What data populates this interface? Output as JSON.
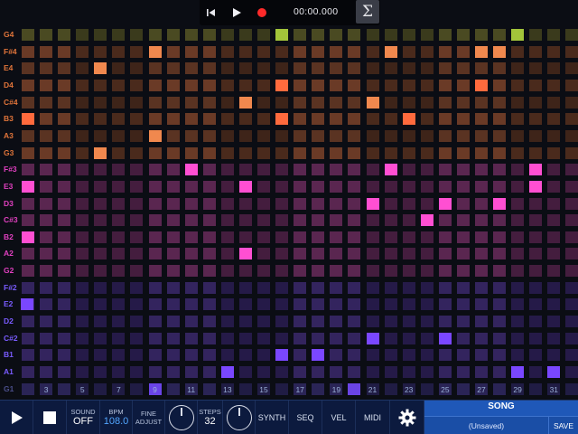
{
  "transport": {
    "time": "00:00.000",
    "sigma": "Σ",
    "icons": [
      "rewind-icon",
      "play-icon",
      "record-icon"
    ]
  },
  "grid": {
    "rows": [
      "G4",
      "F#4",
      "E4",
      "D4",
      "C#4",
      "B3",
      "A3",
      "G3",
      "F#3",
      "E3",
      "D3",
      "C#3",
      "B2",
      "A2",
      "G2",
      "F#2",
      "E2",
      "D2",
      "C#2",
      "B1",
      "A1",
      "G1"
    ],
    "step_numbers": [
      "3",
      "5",
      "7",
      "9",
      "11",
      "13",
      "15",
      "17",
      "19",
      "21",
      "23",
      "25",
      "27",
      "29",
      "31"
    ],
    "active_notes": {
      "G4": [
        15,
        28
      ],
      "F#4": [
        8,
        21,
        26,
        27
      ],
      "E4": [
        5
      ],
      "D4": [
        15,
        26
      ],
      "C#4": [
        13,
        20
      ],
      "B3": [
        1,
        15,
        22
      ],
      "A3": [
        8
      ],
      "G3": [
        5
      ],
      "F#3": [
        10,
        21,
        29
      ],
      "E3": [
        1,
        13,
        29
      ],
      "D3": [
        20,
        24,
        27
      ],
      "C#3": [
        23
      ],
      "B2": [
        1
      ],
      "A2": [
        13
      ],
      "G2": [],
      "F#2": [],
      "E2": [
        0
      ],
      "D2": [],
      "C#2": [
        20,
        24
      ],
      "B1": [
        15,
        17
      ],
      "A1": [
        12,
        28,
        30
      ],
      "G1": [
        8,
        19
      ]
    },
    "colors": {
      "orange_active": "#f0884e",
      "orange_bright": "#ff6a3d",
      "lime_active": "#a3c43a",
      "pink_active": "#ff4fd2",
      "violet_active": "#7a47ff"
    }
  },
  "toolbar": {
    "sound_label": "SOUND",
    "sound_value": "OFF",
    "bpm_label": "BPM",
    "bpm_value": "108.0",
    "fine_label_1": "FINE",
    "fine_label_2": "ADJUST",
    "steps_label": "STEPS",
    "steps_value": "32",
    "synth": "SYNTH",
    "seq": "SEQ",
    "vel": "VEL",
    "midi": "MIDI",
    "song_title": "SONG",
    "song_name": "(Unsaved)",
    "save": "SAVE"
  }
}
